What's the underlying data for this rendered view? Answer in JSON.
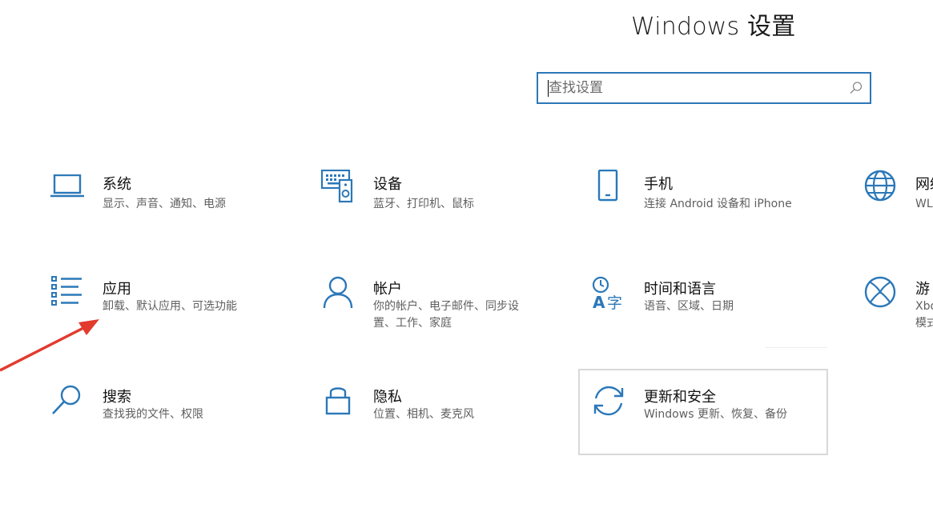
{
  "window": {
    "title": "Windows 设置"
  },
  "search": {
    "placeholder": "查找设置",
    "icon": "search-icon"
  },
  "accent_color": "#2b78b8",
  "tiles": [
    {
      "name": "系统",
      "desc": "显示、声音、通知、电源",
      "icon": "laptop-icon"
    },
    {
      "name": "设备",
      "desc": "蓝牙、打印机、鼠标",
      "icon": "devices-icon"
    },
    {
      "name": "手机",
      "desc": "连接 Android 设备和 iPhone",
      "icon": "phone-icon"
    },
    {
      "name": "网络",
      "desc": "WL",
      "icon": "globe-icon"
    },
    {
      "name": "应用",
      "desc": "卸载、默认应用、可选功能",
      "icon": "apps-list-icon"
    },
    {
      "name": "帐户",
      "desc": "你的帐户、电子邮件、同步设置、工作、家庭",
      "icon": "person-icon"
    },
    {
      "name": "时间和语言",
      "desc": "语音、区域、日期",
      "icon": "time-language-icon"
    },
    {
      "name": "游",
      "desc": "Xbo模式",
      "icon": "xbox-icon"
    },
    {
      "name": "搜索",
      "desc": "查找我的文件、权限",
      "icon": "search-magnifier-icon"
    },
    {
      "name": "隐私",
      "desc": "位置、相机、麦克风",
      "icon": "lock-icon"
    },
    {
      "name": "更新和安全",
      "desc": "Windows 更新、恢复、备份",
      "icon": "sync-icon"
    }
  ],
  "annotation": {
    "arrow_color": "#e23b2e",
    "icon": "red-arrow-annotation"
  }
}
